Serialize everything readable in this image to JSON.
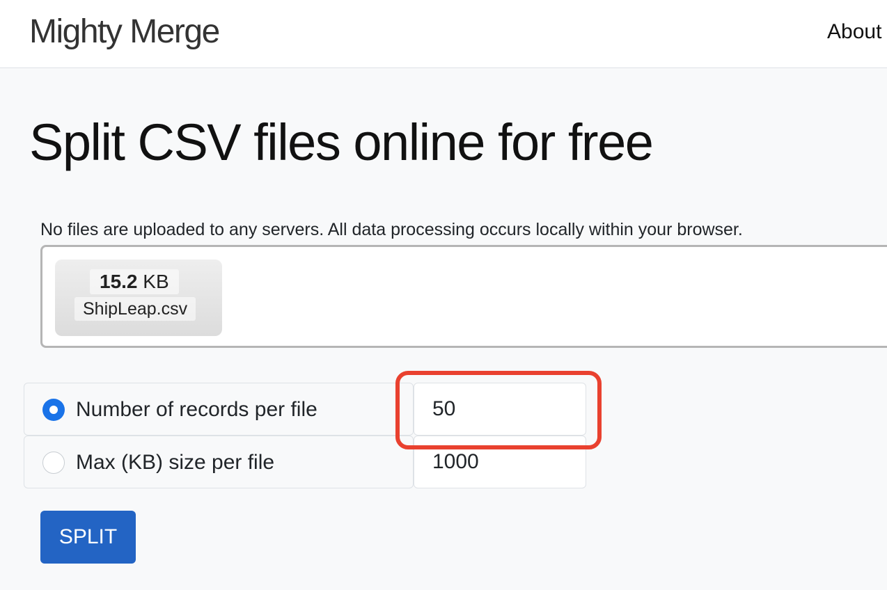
{
  "navbar": {
    "brand": "Mighty Merge",
    "links": [
      {
        "label": "About"
      }
    ]
  },
  "main": {
    "title": "Split CSV files online for free",
    "notice": "No files are uploaded to any servers. All data processing occurs locally within your browser.",
    "file": {
      "size_value": "15.2",
      "size_unit": "KB",
      "name": "ShipLeap.csv"
    },
    "options": [
      {
        "label": "Number of records per file",
        "value": "50",
        "selected": true
      },
      {
        "label": "Max (KB) size per file",
        "value": "1000",
        "selected": false
      }
    ],
    "split_label": "SPLIT"
  },
  "colors": {
    "primary": "#2364c4",
    "radio_checked": "#1a73e8",
    "highlight": "#e9412f",
    "background": "#f8f9fa"
  }
}
